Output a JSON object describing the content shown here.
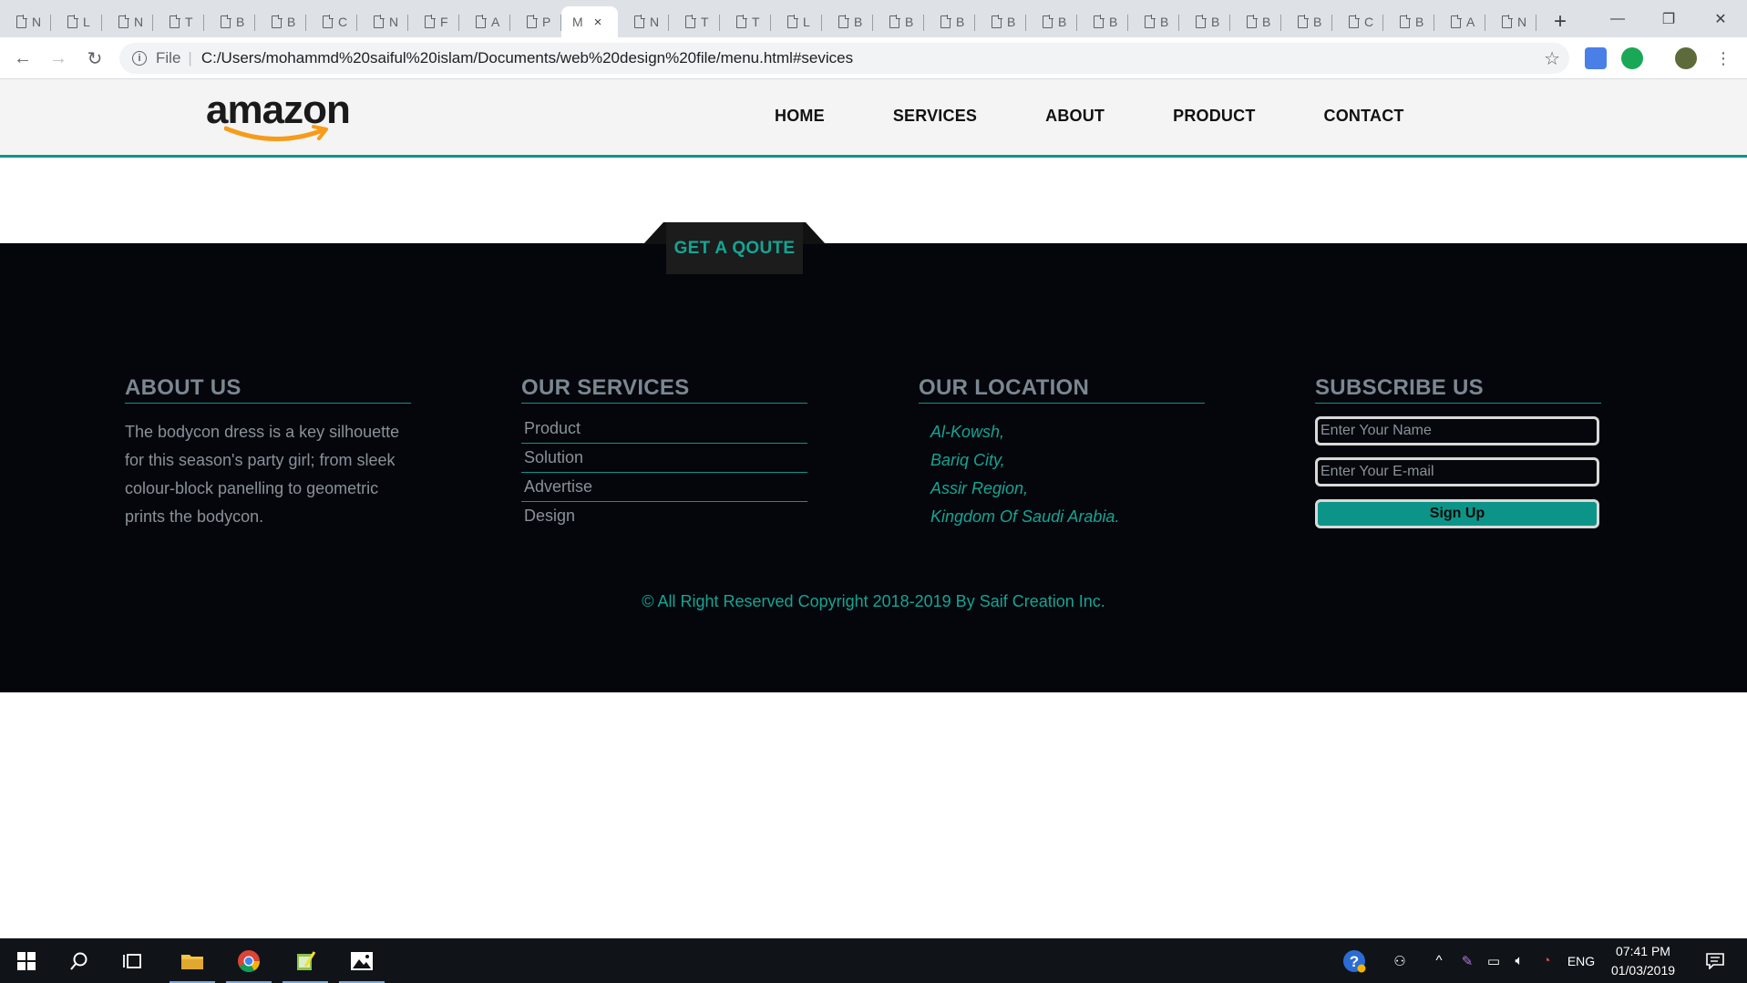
{
  "browser": {
    "tabs": [
      {
        "title": "N"
      },
      {
        "title": "L"
      },
      {
        "title": "N"
      },
      {
        "title": "T"
      },
      {
        "title": "B"
      },
      {
        "title": "B"
      },
      {
        "title": "C"
      },
      {
        "title": "N"
      },
      {
        "title": "F"
      },
      {
        "title": "A"
      },
      {
        "title": "P"
      },
      {
        "title": "M",
        "active": true
      },
      {
        "title": "N"
      },
      {
        "title": "T"
      },
      {
        "title": "T"
      },
      {
        "title": "L"
      },
      {
        "title": "B"
      },
      {
        "title": "B"
      },
      {
        "title": "B"
      },
      {
        "title": "B"
      },
      {
        "title": "B"
      },
      {
        "title": "B"
      },
      {
        "title": "B"
      },
      {
        "title": "B"
      },
      {
        "title": "B"
      },
      {
        "title": "B"
      },
      {
        "title": "C"
      },
      {
        "title": "B"
      },
      {
        "title": "A"
      },
      {
        "title": "N"
      }
    ],
    "active_tab_close": "×",
    "new_tab": "+",
    "window_controls": {
      "minimize": "—",
      "restore": "❐",
      "close": "✕"
    },
    "address": {
      "scheme": "File",
      "url": "C:/Users/mohammd%20saiful%20islam/Documents/web%20design%20file/menu.html#sevices"
    },
    "icons": [
      "back-arrow-icon",
      "forward-arrow-icon",
      "reload-icon",
      "info-icon",
      "star-icon",
      "translate-icon",
      "grammarly-icon",
      "profile-avatar-icon",
      "kebab-menu-icon"
    ]
  },
  "site": {
    "logo": "amazon",
    "nav": [
      "HOME",
      "SERVICES",
      "ABOUT",
      "PRODUCT",
      "CONTACT"
    ],
    "quote_button": "GET A QOUTE",
    "accent_color": "#0d9488",
    "footer": {
      "about": {
        "heading": "ABOUT US",
        "text": "The bodycon dress is a key silhouette for this season's party girl; from sleek colour-block panelling to geometric prints the bodycon."
      },
      "services": {
        "heading": "OUR SERVICES",
        "items": [
          "Product",
          "Solution",
          "Advertise",
          "Design"
        ]
      },
      "location": {
        "heading": "OUR LOCATION",
        "lines": [
          "Al-Kowsh,",
          "Bariq City,",
          "Assir Region,",
          "Kingdom Of Saudi Arabia."
        ]
      },
      "subscribe": {
        "heading": "SUBSCRIBE US",
        "name_placeholder": "Enter Your Name",
        "email_placeholder": "Enter Your E-mail",
        "button": "Sign Up"
      },
      "copyright": "© All Right Reserved Copyright 2018-2019 By Saif Creation Inc."
    }
  },
  "taskbar": {
    "pinned": [
      "windows-start-icon",
      "search-icon",
      "task-view-icon",
      "file-explorer-icon",
      "chrome-icon",
      "notepad-icon",
      "photos-icon"
    ],
    "tray": [
      "help-icon",
      "people-icon",
      "chevron-up-icon",
      "pen-icon",
      "battery-icon",
      "volume-icon",
      "network-icon"
    ],
    "language": "ENG",
    "time": "07:41 PM",
    "date": "01/03/2019"
  }
}
